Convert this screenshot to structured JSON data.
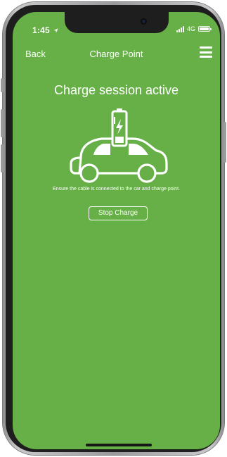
{
  "status_bar": {
    "time": "1:45",
    "location_icon": "location-arrow-icon",
    "network": "4G"
  },
  "nav": {
    "back_label": "Back",
    "title": "Charge Point",
    "menu_icon": "hamburger-menu-icon"
  },
  "main": {
    "heading": "Charge session active",
    "illustration_icon": "car-charging-battery-icon",
    "instructions": "Ensure the cable is connected to the car and charge point.",
    "stop_button_label": "Stop Charge"
  },
  "colors": {
    "background": "#66b047",
    "foreground": "#ffffff",
    "phone_frame": "#1e1e1e"
  }
}
